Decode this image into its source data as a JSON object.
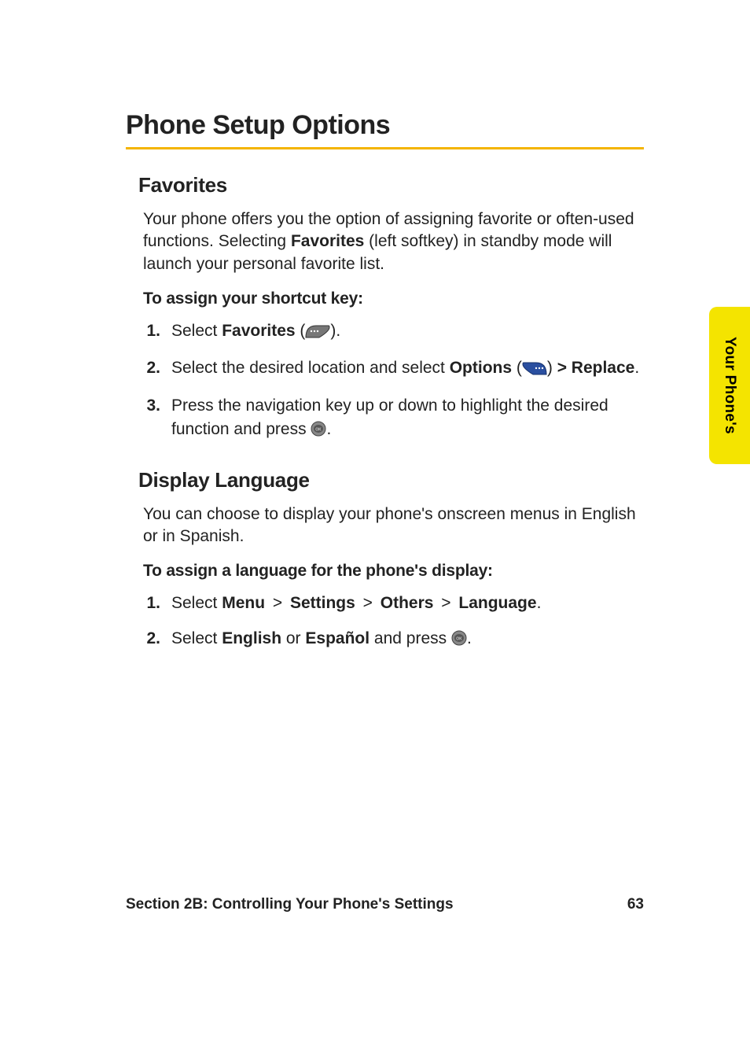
{
  "title": "Phone Setup Options",
  "sidetab": "Your Phone's",
  "favorites": {
    "heading": "Favorites",
    "intro_parts": {
      "p1": "Your phone offers you the option of assigning favorite or often-used functions. Selecting ",
      "b1": "Favorites",
      "p2": " (left softkey) in standby mode will launch your personal favorite list."
    },
    "instr": "To assign your shortcut key:",
    "steps": {
      "s1_num": "1.",
      "s1_a": "Select ",
      "s1_b": "Favorites",
      "s1_c": " (",
      "s1_d": ").",
      "s2_num": "2.",
      "s2_a": "Select the desired location and select ",
      "s2_b": "Options",
      "s2_c": " (",
      "s2_d": ") ",
      "s2_gt": ">",
      "s2_e": " Replace",
      "s2_f": ".",
      "s3_num": "3.",
      "s3_a": "Press the navigation key up or down to highlight the desired function and press ",
      "s3_b": "."
    }
  },
  "display_lang": {
    "heading": "Display Language",
    "intro": "You can choose to display your phone's onscreen menus in English or in Spanish.",
    "instr": "To assign a language for the phone's display:",
    "steps": {
      "s1_num": "1.",
      "s1_a": "Select ",
      "s1_b": "Menu",
      "s1_gt1": " > ",
      "s1_c": "Settings",
      "s1_gt2": " > ",
      "s1_d": "Others",
      "s1_gt3": " > ",
      "s1_e": "Language",
      "s1_f": ".",
      "s2_num": "2.",
      "s2_a": "Select ",
      "s2_b": "English",
      "s2_c": " or ",
      "s2_d": "Español",
      "s2_e": " and press ",
      "s2_f": "."
    }
  },
  "footer": {
    "section": "Section 2B: Controlling Your Phone's Settings",
    "page": "63"
  }
}
